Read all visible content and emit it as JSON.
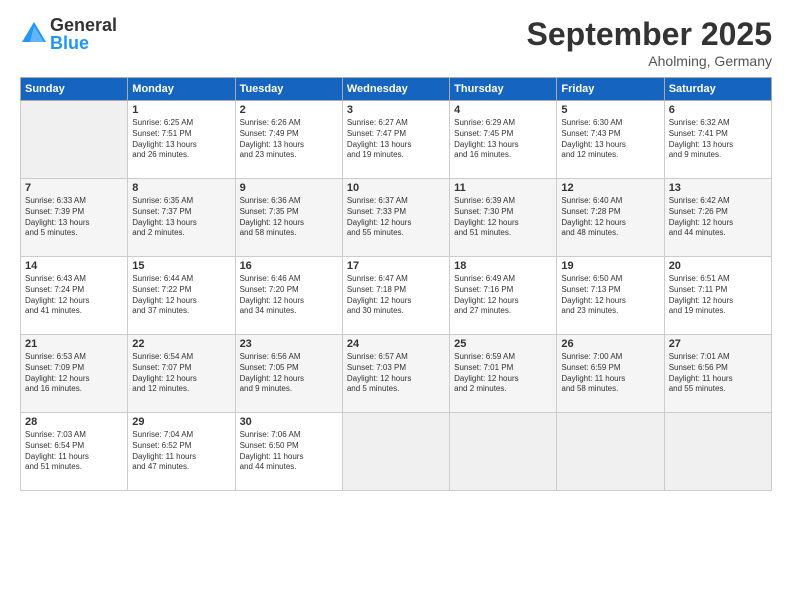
{
  "logo": {
    "general": "General",
    "blue": "Blue"
  },
  "title": "September 2025",
  "location": "Aholming, Germany",
  "days_of_week": [
    "Sunday",
    "Monday",
    "Tuesday",
    "Wednesday",
    "Thursday",
    "Friday",
    "Saturday"
  ],
  "weeks": [
    [
      {
        "day": "",
        "info": ""
      },
      {
        "day": "1",
        "info": "Sunrise: 6:25 AM\nSunset: 7:51 PM\nDaylight: 13 hours\nand 26 minutes."
      },
      {
        "day": "2",
        "info": "Sunrise: 6:26 AM\nSunset: 7:49 PM\nDaylight: 13 hours\nand 23 minutes."
      },
      {
        "day": "3",
        "info": "Sunrise: 6:27 AM\nSunset: 7:47 PM\nDaylight: 13 hours\nand 19 minutes."
      },
      {
        "day": "4",
        "info": "Sunrise: 6:29 AM\nSunset: 7:45 PM\nDaylight: 13 hours\nand 16 minutes."
      },
      {
        "day": "5",
        "info": "Sunrise: 6:30 AM\nSunset: 7:43 PM\nDaylight: 13 hours\nand 12 minutes."
      },
      {
        "day": "6",
        "info": "Sunrise: 6:32 AM\nSunset: 7:41 PM\nDaylight: 13 hours\nand 9 minutes."
      }
    ],
    [
      {
        "day": "7",
        "info": "Sunrise: 6:33 AM\nSunset: 7:39 PM\nDaylight: 13 hours\nand 5 minutes."
      },
      {
        "day": "8",
        "info": "Sunrise: 6:35 AM\nSunset: 7:37 PM\nDaylight: 13 hours\nand 2 minutes."
      },
      {
        "day": "9",
        "info": "Sunrise: 6:36 AM\nSunset: 7:35 PM\nDaylight: 12 hours\nand 58 minutes."
      },
      {
        "day": "10",
        "info": "Sunrise: 6:37 AM\nSunset: 7:33 PM\nDaylight: 12 hours\nand 55 minutes."
      },
      {
        "day": "11",
        "info": "Sunrise: 6:39 AM\nSunset: 7:30 PM\nDaylight: 12 hours\nand 51 minutes."
      },
      {
        "day": "12",
        "info": "Sunrise: 6:40 AM\nSunset: 7:28 PM\nDaylight: 12 hours\nand 48 minutes."
      },
      {
        "day": "13",
        "info": "Sunrise: 6:42 AM\nSunset: 7:26 PM\nDaylight: 12 hours\nand 44 minutes."
      }
    ],
    [
      {
        "day": "14",
        "info": "Sunrise: 6:43 AM\nSunset: 7:24 PM\nDaylight: 12 hours\nand 41 minutes."
      },
      {
        "day": "15",
        "info": "Sunrise: 6:44 AM\nSunset: 7:22 PM\nDaylight: 12 hours\nand 37 minutes."
      },
      {
        "day": "16",
        "info": "Sunrise: 6:46 AM\nSunset: 7:20 PM\nDaylight: 12 hours\nand 34 minutes."
      },
      {
        "day": "17",
        "info": "Sunrise: 6:47 AM\nSunset: 7:18 PM\nDaylight: 12 hours\nand 30 minutes."
      },
      {
        "day": "18",
        "info": "Sunrise: 6:49 AM\nSunset: 7:16 PM\nDaylight: 12 hours\nand 27 minutes."
      },
      {
        "day": "19",
        "info": "Sunrise: 6:50 AM\nSunset: 7:13 PM\nDaylight: 12 hours\nand 23 minutes."
      },
      {
        "day": "20",
        "info": "Sunrise: 6:51 AM\nSunset: 7:11 PM\nDaylight: 12 hours\nand 19 minutes."
      }
    ],
    [
      {
        "day": "21",
        "info": "Sunrise: 6:53 AM\nSunset: 7:09 PM\nDaylight: 12 hours\nand 16 minutes."
      },
      {
        "day": "22",
        "info": "Sunrise: 6:54 AM\nSunset: 7:07 PM\nDaylight: 12 hours\nand 12 minutes."
      },
      {
        "day": "23",
        "info": "Sunrise: 6:56 AM\nSunset: 7:05 PM\nDaylight: 12 hours\nand 9 minutes."
      },
      {
        "day": "24",
        "info": "Sunrise: 6:57 AM\nSunset: 7:03 PM\nDaylight: 12 hours\nand 5 minutes."
      },
      {
        "day": "25",
        "info": "Sunrise: 6:59 AM\nSunset: 7:01 PM\nDaylight: 12 hours\nand 2 minutes."
      },
      {
        "day": "26",
        "info": "Sunrise: 7:00 AM\nSunset: 6:59 PM\nDaylight: 11 hours\nand 58 minutes."
      },
      {
        "day": "27",
        "info": "Sunrise: 7:01 AM\nSunset: 6:56 PM\nDaylight: 11 hours\nand 55 minutes."
      }
    ],
    [
      {
        "day": "28",
        "info": "Sunrise: 7:03 AM\nSunset: 6:54 PM\nDaylight: 11 hours\nand 51 minutes."
      },
      {
        "day": "29",
        "info": "Sunrise: 7:04 AM\nSunset: 6:52 PM\nDaylight: 11 hours\nand 47 minutes."
      },
      {
        "day": "30",
        "info": "Sunrise: 7:06 AM\nSunset: 6:50 PM\nDaylight: 11 hours\nand 44 minutes."
      },
      {
        "day": "",
        "info": ""
      },
      {
        "day": "",
        "info": ""
      },
      {
        "day": "",
        "info": ""
      },
      {
        "day": "",
        "info": ""
      }
    ]
  ]
}
